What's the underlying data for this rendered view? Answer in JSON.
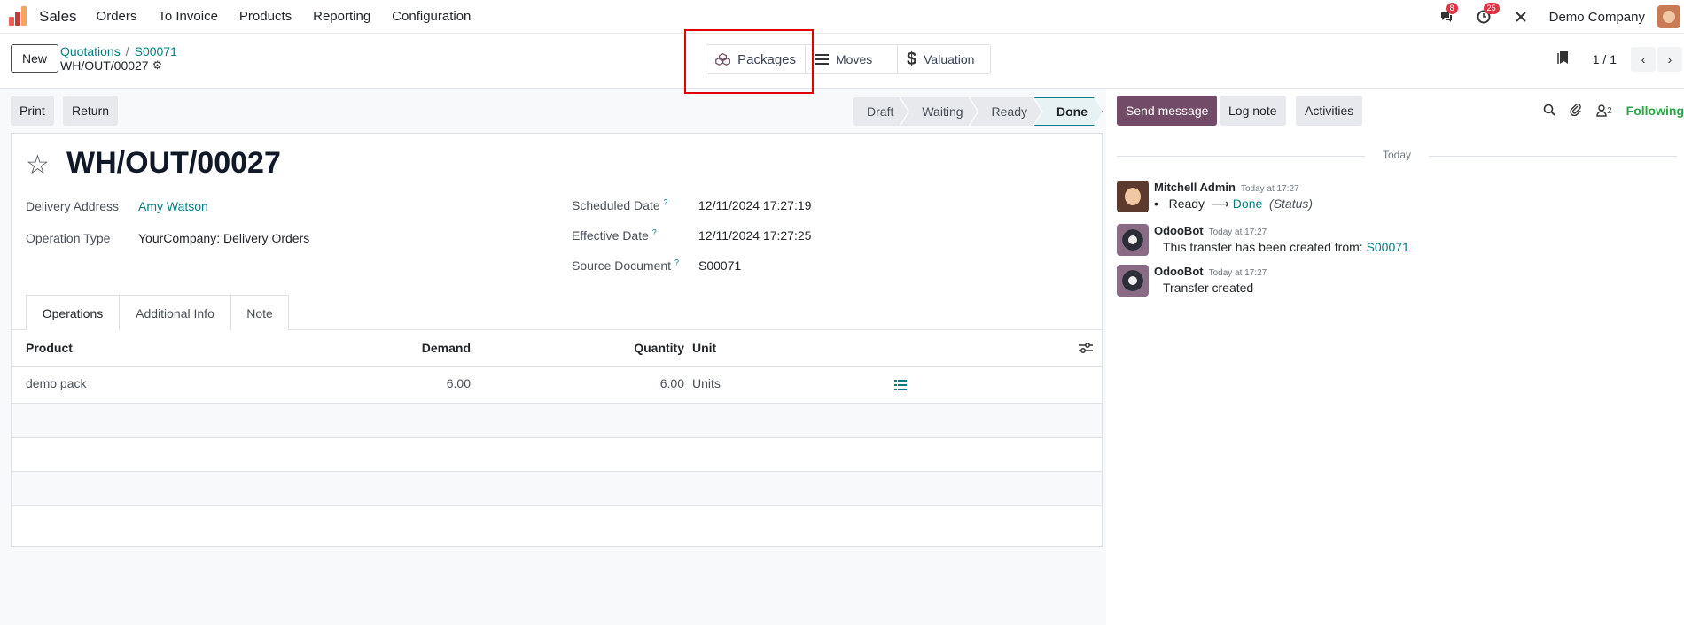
{
  "navbar": {
    "app_name": "Sales",
    "menu": [
      "Orders",
      "To Invoice",
      "Products",
      "Reporting",
      "Configuration"
    ],
    "messages_badge": "8",
    "activities_badge": "25",
    "company": "Demo Company"
  },
  "control": {
    "new_label": "New",
    "breadcrumb": [
      "Quotations",
      "S00071"
    ],
    "record_name": "WH/OUT/00027",
    "smart_buttons": {
      "packages": "Packages",
      "moves": "Moves",
      "valuation": "Valuation"
    },
    "pager": "1 / 1"
  },
  "statusbar": {
    "print": "Print",
    "return": "Return",
    "stages": [
      "Draft",
      "Waiting",
      "Ready",
      "Done"
    ],
    "current_stage": "Done"
  },
  "form": {
    "title": "WH/OUT/00027",
    "delivery_address_label": "Delivery Address",
    "delivery_address": "Amy Watson",
    "operation_type_label": "Operation Type",
    "operation_type": "YourCompany: Delivery Orders",
    "scheduled_date_label": "Scheduled Date",
    "scheduled_date": "12/11/2024 17:27:19",
    "effective_date_label": "Effective Date",
    "effective_date": "12/11/2024 17:27:25",
    "source_document_label": "Source Document",
    "source_document": "S00071",
    "help_mark": "?",
    "tabs": [
      "Operations",
      "Additional Info",
      "Note"
    ],
    "table": {
      "headers": {
        "product": "Product",
        "demand": "Demand",
        "quantity": "Quantity",
        "unit": "Unit"
      },
      "rows": [
        {
          "product": "demo pack",
          "demand": "6.00",
          "quantity": "6.00",
          "unit": "Units"
        }
      ]
    }
  },
  "chatter": {
    "send_message": "Send message",
    "log_note": "Log note",
    "activities": "Activities",
    "followers_count": "2",
    "following": "Following",
    "today": "Today",
    "messages": [
      {
        "author": "Mitchell Admin",
        "time": "Today at 17:27",
        "from": "Ready",
        "arrow": "⟶",
        "to": "Done",
        "field": "(Status)"
      },
      {
        "author": "OdooBot",
        "time": "Today at 17:27",
        "text": "This transfer has been created from:",
        "link": "S00071"
      },
      {
        "author": "OdooBot",
        "time": "Today at 17:27",
        "text": "Transfer created"
      }
    ]
  },
  "colors": {
    "primary": "#714b67",
    "link": "#017e84",
    "highlight": "#e20000",
    "following": "#28a745"
  }
}
